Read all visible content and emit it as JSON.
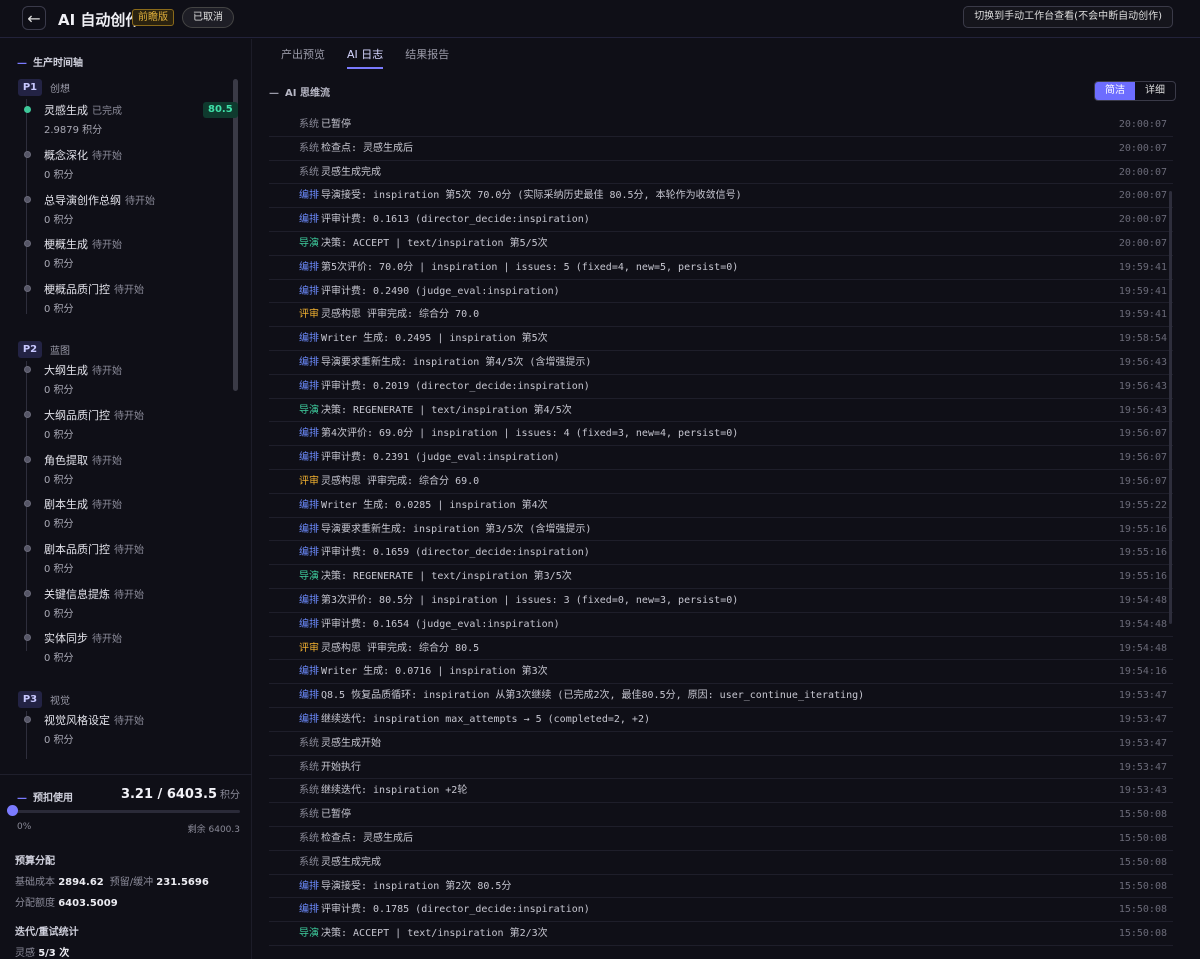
{
  "header": {
    "back_icon": "arrow-left-icon",
    "title": "AI 自动创作",
    "beta_badge": "前瞻版",
    "status_badge": "已取消",
    "switch_button": "切换到手动工作台查看(不会中断自动创作)"
  },
  "sidebar": {
    "title": "生产时间轴",
    "phases": [
      {
        "code": "P1",
        "name": "创想"
      },
      {
        "code": "P2",
        "name": "蓝图"
      },
      {
        "code": "P3",
        "name": "视觉"
      }
    ],
    "steps": [
      {
        "name": "灵感生成",
        "state": "已完成",
        "points": "2.9879 积分",
        "score": "80.5"
      },
      {
        "name": "概念深化",
        "state": "待开始",
        "points": "0 积分"
      },
      {
        "name": "总导演创作总纲",
        "state": "待开始",
        "points": "0 积分"
      },
      {
        "name": "梗概生成",
        "state": "待开始",
        "points": "0 积分"
      },
      {
        "name": "梗概品质门控",
        "state": "待开始",
        "points": "0 积分"
      },
      {
        "name": "大纲生成",
        "state": "待开始",
        "points": "0 积分"
      },
      {
        "name": "大纲品质门控",
        "state": "待开始",
        "points": "0 积分"
      },
      {
        "name": "角色提取",
        "state": "待开始",
        "points": "0 积分"
      },
      {
        "name": "剧本生成",
        "state": "待开始",
        "points": "0 积分"
      },
      {
        "name": "剧本品质门控",
        "state": "待开始",
        "points": "0 积分"
      },
      {
        "name": "关键信息提炼",
        "state": "待开始",
        "points": "0 积分"
      },
      {
        "name": "实体同步",
        "state": "待开始",
        "points": "0 积分"
      },
      {
        "name": "视觉风格设定",
        "state": "待开始",
        "points": "0 积分"
      }
    ]
  },
  "budget": {
    "title": "预扣使用",
    "value": "3.21 / 6403.5",
    "unit": "积分",
    "used_fraction": 0.0005,
    "pct": "0%",
    "remaining": "剩余 6400.3",
    "alloc_title": "预算分配",
    "base_label": "基础成本",
    "base_value": "2894.62",
    "reserve_label": "预留/缓冲",
    "reserve_value": "231.5696",
    "quota_label": "分配额度",
    "quota_value": "6403.5009",
    "iter_title": "迭代/重试统计",
    "iter_label": "灵感",
    "iter_value": "5/3 次"
  },
  "tabs": [
    "产出预览",
    "AI 日志",
    "结果报告"
  ],
  "stream": {
    "title": "AI 思维流",
    "toggle": [
      "简洁",
      "详细"
    ]
  },
  "colors": {
    "accent": "#7b7bff",
    "edit": "#6d8cff",
    "director": "#3fd0a0",
    "review": "#f0b030",
    "success": "#3ec89a"
  },
  "logs": [
    {
      "tag": "系统",
      "kind": "sys",
      "msg": "已暂停",
      "time": "20:00:07"
    },
    {
      "tag": "系统",
      "kind": "sys",
      "msg": "检查点: 灵感生成后",
      "time": "20:00:07"
    },
    {
      "tag": "系统",
      "kind": "sys",
      "msg": "灵感生成完成",
      "time": "20:00:07"
    },
    {
      "tag": "编排",
      "kind": "edit",
      "msg": "导演接受: inspiration 第5次 70.0分 (实际采纳历史最佳 80.5分, 本轮作为收敛信号)",
      "time": "20:00:07"
    },
    {
      "tag": "编排",
      "kind": "edit",
      "msg": "评审计费: 0.1613 (director_decide:inspiration)",
      "time": "20:00:07"
    },
    {
      "tag": "导演",
      "kind": "director",
      "msg": "决策: ACCEPT | text/inspiration 第5/5次",
      "time": "20:00:07"
    },
    {
      "tag": "编排",
      "kind": "edit",
      "msg": "第5次评价: 70.0分 | inspiration | issues: 5 (fixed=4, new=5, persist=0)",
      "time": "19:59:41"
    },
    {
      "tag": "编排",
      "kind": "edit",
      "msg": "评审计费: 0.2490 (judge_eval:inspiration)",
      "time": "19:59:41"
    },
    {
      "tag": "评审",
      "kind": "review",
      "msg": "灵感构思 评审完成: 综合分 70.0",
      "time": "19:59:41"
    },
    {
      "tag": "编排",
      "kind": "edit",
      "msg": "Writer 生成: 0.2495 | inspiration 第5次",
      "time": "19:58:54"
    },
    {
      "tag": "编排",
      "kind": "edit",
      "msg": "导演要求重新生成: inspiration 第4/5次 (含增强提示)",
      "time": "19:56:43"
    },
    {
      "tag": "编排",
      "kind": "edit",
      "msg": "评审计费: 0.2019 (director_decide:inspiration)",
      "time": "19:56:43"
    },
    {
      "tag": "导演",
      "kind": "director",
      "msg": "决策: REGENERATE | text/inspiration 第4/5次",
      "time": "19:56:43"
    },
    {
      "tag": "编排",
      "kind": "edit",
      "msg": "第4次评价: 69.0分 | inspiration | issues: 4 (fixed=3, new=4, persist=0)",
      "time": "19:56:07"
    },
    {
      "tag": "编排",
      "kind": "edit",
      "msg": "评审计费: 0.2391 (judge_eval:inspiration)",
      "time": "19:56:07"
    },
    {
      "tag": "评审",
      "kind": "review",
      "msg": "灵感构思 评审完成: 综合分 69.0",
      "time": "19:56:07"
    },
    {
      "tag": "编排",
      "kind": "edit",
      "msg": "Writer 生成: 0.0285 | inspiration 第4次",
      "time": "19:55:22"
    },
    {
      "tag": "编排",
      "kind": "edit",
      "msg": "导演要求重新生成: inspiration 第3/5次 (含增强提示)",
      "time": "19:55:16"
    },
    {
      "tag": "编排",
      "kind": "edit",
      "msg": "评审计费: 0.1659 (director_decide:inspiration)",
      "time": "19:55:16"
    },
    {
      "tag": "导演",
      "kind": "director",
      "msg": "决策: REGENERATE | text/inspiration 第3/5次",
      "time": "19:55:16"
    },
    {
      "tag": "编排",
      "kind": "edit",
      "msg": "第3次评价: 80.5分 | inspiration | issues: 3 (fixed=0, new=3, persist=0)",
      "time": "19:54:48"
    },
    {
      "tag": "编排",
      "kind": "edit",
      "msg": "评审计费: 0.1654 (judge_eval:inspiration)",
      "time": "19:54:48"
    },
    {
      "tag": "评审",
      "kind": "review",
      "msg": "灵感构思 评审完成: 综合分 80.5",
      "time": "19:54:48"
    },
    {
      "tag": "编排",
      "kind": "edit",
      "msg": "Writer 生成: 0.0716 | inspiration 第3次",
      "time": "19:54:16"
    },
    {
      "tag": "编排",
      "kind": "edit",
      "msg": "Q8.5 恢复品质循环: inspiration 从第3次继续 (已完成2次, 最佳80.5分, 原因: user_continue_iterating)",
      "time": "19:53:47"
    },
    {
      "tag": "编排",
      "kind": "edit",
      "msg": "继续迭代: inspiration max_attempts → 5 (completed=2, +2)",
      "time": "19:53:47"
    },
    {
      "tag": "系统",
      "kind": "sys",
      "msg": "灵感生成开始",
      "time": "19:53:47"
    },
    {
      "tag": "系统",
      "kind": "sys",
      "msg": "开始执行",
      "time": "19:53:47"
    },
    {
      "tag": "系统",
      "kind": "sys",
      "msg": "继续迭代: inspiration +2轮",
      "time": "19:53:43"
    },
    {
      "tag": "系统",
      "kind": "sys",
      "msg": "已暂停",
      "time": "15:50:08"
    },
    {
      "tag": "系统",
      "kind": "sys",
      "msg": "检查点: 灵感生成后",
      "time": "15:50:08"
    },
    {
      "tag": "系统",
      "kind": "sys",
      "msg": "灵感生成完成",
      "time": "15:50:08"
    },
    {
      "tag": "编排",
      "kind": "edit",
      "msg": "导演接受: inspiration 第2次 80.5分",
      "time": "15:50:08"
    },
    {
      "tag": "编排",
      "kind": "edit",
      "msg": "评审计费: 0.1785 (director_decide:inspiration)",
      "time": "15:50:08"
    },
    {
      "tag": "导演",
      "kind": "director",
      "msg": "决策: ACCEPT | text/inspiration 第2/3次",
      "time": "15:50:08"
    }
  ]
}
